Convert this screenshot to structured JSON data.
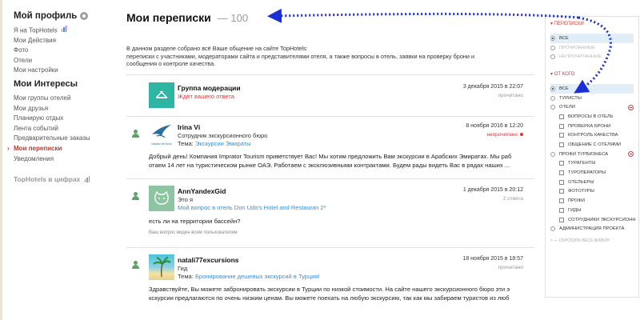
{
  "sidebar": {
    "profile_title": "Мой профиль",
    "profile_items": [
      "Я на TopHotels",
      "Мои Действия",
      "Фото",
      "Отели",
      "Мои настройки"
    ],
    "interests_title": "Мои Интересы",
    "interest_items": [
      "Мои группы отелей",
      "Мои друзья",
      "Планирую отдых",
      "Лента событий",
      "Предварительные заказы",
      "Мои переписки",
      "Уведомления"
    ],
    "active_item": "Мои переписки",
    "tophotels_numbers": "TopHotels в цифрах"
  },
  "main": {
    "title": "Мои переписки",
    "count": "— 100",
    "intro_line1": "В данном разделе собрано всё Ваше общение на сайте TopHotels:",
    "intro_line2": "переписки с участниками, модераторами сайта и представителями отеля, а также вопросы в отель, заявки на проверку брони и",
    "intro_line3": "сообщения о контроле качества.",
    "topic_label": "Тема:",
    "messages": [
      {
        "name": "Группа модерации",
        "subtitle": "Ждёт вашего ответа",
        "date": "3 декабря 2015 в 22:07",
        "status": "прочитано"
      },
      {
        "name": "Irina Vi",
        "subtitle": "Сотрудник экскурсионного бюро",
        "topic": "Экскурсии Эмираты",
        "date": "8 ноября 2016 в 12:20",
        "status": "непрочитано",
        "avatar_caption": "Imprator ltd Sohro",
        "body_line1": "Добрый день! Компания Imprator Tourism приветствует Вас! Мы хотим предложить Вам экскурсии в Арабских Эмиратах. Мы раб",
        "body_line2": "отаем 14 лет на туристическом рынке ОАЭ. Работаем с эксклюзивными контрактами. Будем рады видеть Вас в рядах наших ..."
      },
      {
        "name": "AnnYandexGid",
        "subtitle": "Это я",
        "link": "Мой вопрос в отель Don Udo's Hotel and Restauran 2*",
        "date": "1 декабря 2015 в 20:12",
        "status": "2 ответа",
        "body_line1": "есть ли на территории бассейн?",
        "note": "Ваш вопрос виден всем пользователям"
      },
      {
        "name": "natali77excursions",
        "subtitle": "Гид",
        "topic": "Бронирование дешевых экскурсий в Турции!",
        "date": "18 ноября 2015 в 18:57",
        "status": "прочитано",
        "body_line1": "Здравствуйте, Вы можете забронировать экскурсии в Турции по низкой стоимости. На сайте нашего экскурсионного бюро эти э",
        "body_line2": "кскурсии предлагаются по очень низким ценам. Вы можете поехать на любую экскурсию, так как мы забираем туристов из люб"
      }
    ]
  },
  "filters": {
    "group1_title": "Переписки",
    "group1": [
      "Все",
      "Прочитанные",
      "Непрочитанные"
    ],
    "group2_title": "От кого",
    "group2_all": "Все",
    "tourists": "Туристы",
    "hotels": "Отели",
    "hotel_subs": [
      "Вопросы в отель",
      "Проверка брони",
      "Контроль качества",
      "Общение с отелями"
    ],
    "profi": "Профи Турбизнеса",
    "profi_subs": [
      "Турагенты",
      "Туроператоры",
      "Отельеры",
      "Фототуры",
      "Профи",
      "Гиды",
      "Сотрудники экскурсионн"
    ],
    "admin": "Администрация проекта",
    "reset": "× — Сбросить весь фильтр"
  },
  "colors": {
    "accent_red": "#d23b3b",
    "link_blue": "#3a8fd6",
    "arrow_blue": "#1a2fd6",
    "selected_bg": "#e1eef7"
  }
}
